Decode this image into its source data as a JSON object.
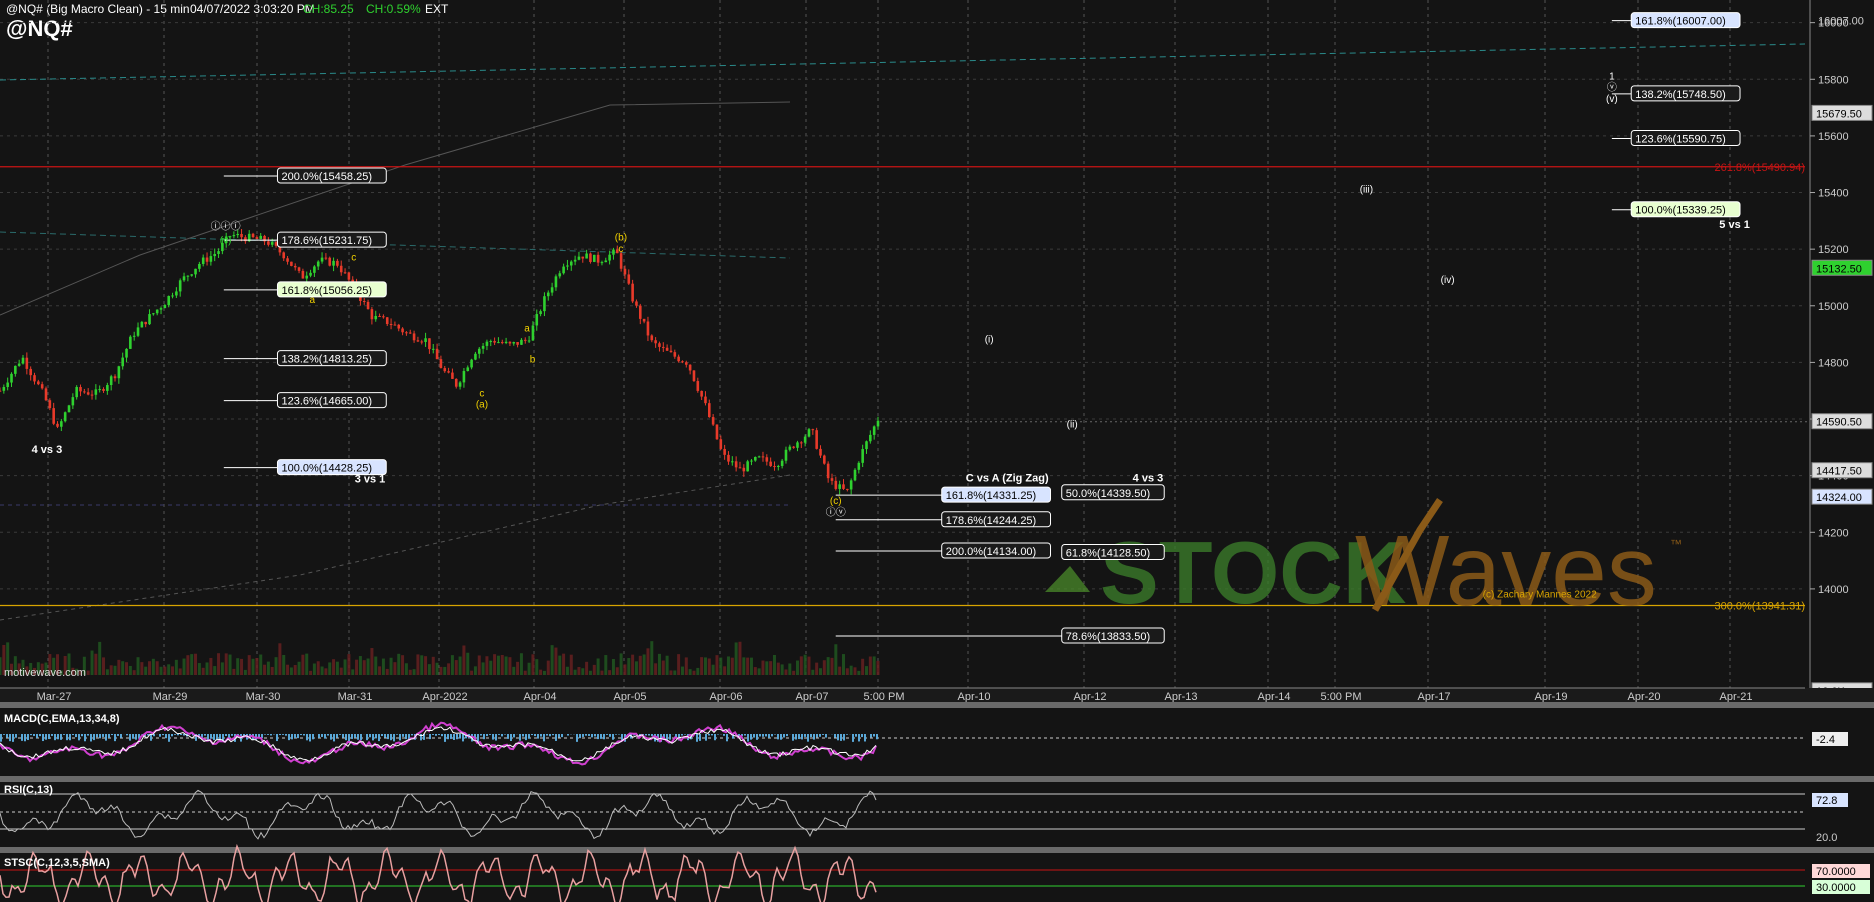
{
  "header": {
    "title": "@NQ# (Big Macro Clean) - 15 min",
    "datetime": "04/07/2022 3:03:20 PM",
    "change": "CH:85.25",
    "change_pct": "CH:0.59%",
    "session": "EXT",
    "symbol": "@NQ#"
  },
  "colors": {
    "background": "#141414",
    "up_candle": "#2fd12f",
    "down_candle": "#e83a2a",
    "fib_box_bg": "#1a1a1a",
    "fib_highlight_green": "#e8ffd0",
    "fib_highlight_blue": "#d8e4ff",
    "red_level": "#c81414",
    "orange_level": "#d8a400",
    "wave_label_yellow": "#f0d000",
    "watermark": "#4a8a2a"
  },
  "chart_data": {
    "type": "candlestick",
    "interval": "15 min",
    "ylim": [
      13650,
      16080
    ],
    "yticks": [
      16000,
      15800,
      15600,
      15400,
      15200,
      15000,
      14800,
      14600,
      14400,
      14200,
      14000
    ],
    "xticks": [
      "Mar-27",
      "Mar-29",
      "Mar-30",
      "Mar-31",
      "Apr-2022",
      "Apr-04",
      "Apr-05",
      "Apr-06",
      "Apr-07",
      "5:00 PM",
      "Apr-10",
      "Apr-12",
      "Apr-13",
      "Apr-14",
      "5:00 PM",
      "Apr-17",
      "Apr-19",
      "Apr-20",
      "Apr-21"
    ],
    "price_path": [
      [
        0.0,
        14700
      ],
      [
        0.5,
        14820
      ],
      [
        1.0,
        14680
      ],
      [
        1.3,
        14560
      ],
      [
        1.7,
        14700
      ],
      [
        2.2,
        14690
      ],
      [
        2.6,
        14760
      ],
      [
        3.0,
        14900
      ],
      [
        3.3,
        14950
      ],
      [
        3.7,
        15010
      ],
      [
        4.1,
        15090
      ],
      [
        4.5,
        15150
      ],
      [
        4.9,
        15190
      ],
      [
        5.2,
        15250
      ],
      [
        5.6,
        15240
      ],
      [
        6.0,
        15230
      ],
      [
        6.4,
        15180
      ],
      [
        6.8,
        15100
      ],
      [
        7.2,
        15160
      ],
      [
        7.6,
        15150
      ],
      [
        8.0,
        15060
      ],
      [
        8.4,
        14960
      ],
      [
        8.8,
        14940
      ],
      [
        9.2,
        14900
      ],
      [
        9.6,
        14880
      ],
      [
        10.0,
        14770
      ],
      [
        10.3,
        14720
      ],
      [
        10.7,
        14840
      ],
      [
        11.1,
        14880
      ],
      [
        11.5,
        14860
      ],
      [
        11.9,
        14880
      ],
      [
        12.3,
        15030
      ],
      [
        12.7,
        15150
      ],
      [
        13.1,
        15180
      ],
      [
        13.5,
        15160
      ],
      [
        13.9,
        15190
      ],
      [
        14.3,
        15010
      ],
      [
        14.7,
        14870
      ],
      [
        15.1,
        14830
      ],
      [
        15.5,
        14800
      ],
      [
        15.9,
        14650
      ],
      [
        16.3,
        14470
      ],
      [
        16.7,
        14420
      ],
      [
        17.1,
        14460
      ],
      [
        17.5,
        14440
      ],
      [
        17.9,
        14510
      ],
      [
        18.3,
        14560
      ],
      [
        18.7,
        14380
      ],
      [
        19.1,
        14340
      ],
      [
        19.4,
        14470
      ],
      [
        19.8,
        14600
      ]
    ],
    "current_price": "14590.50",
    "price_labels": [
      {
        "text": "16007.00",
        "value": 16007,
        "box": false
      },
      {
        "text": "15679.50",
        "value": 15679.5,
        "box": true
      },
      {
        "text": "15132.50",
        "value": 15132.5,
        "box": true,
        "green": true
      },
      {
        "text": "14590.50",
        "value": 14590.5,
        "box": true
      },
      {
        "text": "14417.50",
        "value": 14417.5,
        "box": true
      },
      {
        "text": "14324.00",
        "value": 14324,
        "box": true,
        "blue": true
      },
      {
        "text": "16.6K",
        "value": 13640,
        "box": true
      }
    ],
    "fib_levels": [
      {
        "label": "200.0%(15458.25)",
        "value": 15458.25,
        "x0": 0.124,
        "x1": 0.214
      },
      {
        "label": "178.6%(15231.75)",
        "value": 15231.75,
        "x0": 0.124,
        "x1": 0.214
      },
      {
        "label": "161.8%(15056.25)",
        "value": 15056.25,
        "x0": 0.124,
        "x1": 0.214,
        "highlight": "green"
      },
      {
        "label": "138.2%(14813.25)",
        "value": 14813.25,
        "x0": 0.124,
        "x1": 0.214
      },
      {
        "label": "123.6%(14665.00)",
        "value": 14665,
        "x0": 0.124,
        "x1": 0.214
      },
      {
        "label": "100.0%(14428.25)",
        "value": 14428.25,
        "x0": 0.124,
        "x1": 0.214,
        "highlight": "blue"
      },
      {
        "label": "161.8%(14331.25)",
        "value": 14331.25,
        "x0": 0.463,
        "x1": 0.582,
        "highlight": "blue"
      },
      {
        "label": "178.6%(14244.25)",
        "value": 14244.25,
        "x0": 0.463,
        "x1": 0.582
      },
      {
        "label": "200.0%(14134.00)",
        "value": 14134,
        "x0": 0.463,
        "x1": 0.582
      },
      {
        "label": "50.0%(14339.50)",
        "value": 14339.5,
        "x0": 0.595,
        "x1": 0.645
      },
      {
        "label": "61.8%(14128.50)",
        "value": 14128.5,
        "x0": 0.595,
        "x1": 0.645
      },
      {
        "label": "78.6%(13833.50)",
        "value": 13833.5,
        "x0": 0.463,
        "x1": 0.645
      },
      {
        "label": "161.8%(16007.00)",
        "value": 16007,
        "x0": 0.893,
        "x1": 0.964,
        "highlight": "blue"
      },
      {
        "label": "138.2%(15748.50)",
        "value": 15748.5,
        "x0": 0.893,
        "x1": 0.964
      },
      {
        "label": "123.6%(15590.75)",
        "value": 15590.75,
        "x0": 0.893,
        "x1": 0.964
      },
      {
        "label": "100.0%(15339.25)",
        "value": 15339.25,
        "x0": 0.893,
        "x1": 0.964,
        "highlight": "green"
      }
    ],
    "horizontal_levels": [
      {
        "label": "261.8%(15490.94)",
        "value": 15490.94,
        "color": "#c81414"
      },
      {
        "label": "300.0%(13941.31)",
        "value": 13941.31,
        "color": "#d8a400"
      }
    ],
    "annotations": [
      {
        "text": "ⓘⓘⓘ",
        "x": 0.125,
        "value": 15270,
        "color": "#ffffff"
      },
      {
        "text": "(v)",
        "x": 0.125,
        "value": 15220,
        "color": "#2fd12f"
      },
      {
        "text": "a",
        "x": 0.173,
        "value": 15010,
        "color": "#f0d000"
      },
      {
        "text": "c",
        "x": 0.196,
        "value": 15160,
        "color": "#f0d000"
      },
      {
        "text": "c",
        "x": 0.267,
        "value": 14680,
        "color": "#f0d000"
      },
      {
        "text": "(a)",
        "x": 0.267,
        "value": 14640,
        "color": "#f0d000"
      },
      {
        "text": "a",
        "x": 0.292,
        "value": 14910,
        "color": "#f0d000"
      },
      {
        "text": "b",
        "x": 0.295,
        "value": 14800,
        "color": "#f0d000"
      },
      {
        "text": "(b)",
        "x": 0.344,
        "value": 15230,
        "color": "#f0d000"
      },
      {
        "text": "c",
        "x": 0.344,
        "value": 15190,
        "color": "#f0d000"
      },
      {
        "text": "(c)",
        "x": 0.463,
        "value": 14300,
        "color": "#f0d000"
      },
      {
        "text": "ⓘⓥ",
        "x": 0.463,
        "value": 14260,
        "color": "#ffffff"
      },
      {
        "text": "4 vs 3",
        "x": 0.026,
        "value": 14480,
        "color": "#ffffff"
      },
      {
        "text": "3 vs 1",
        "x": 0.205,
        "value": 14375,
        "color": "#ffffff"
      },
      {
        "text": "C vs A (Zig Zag)",
        "x": 0.558,
        "value": 14380,
        "color": "#ffffff"
      },
      {
        "text": "4 vs 3",
        "x": 0.636,
        "value": 14380,
        "color": "#ffffff"
      },
      {
        "text": "5 vs 1",
        "x": 0.961,
        "value": 15275,
        "color": "#ffffff"
      },
      {
        "text": "1",
        "x": 0.893,
        "value": 15800,
        "color": "#ffffff"
      },
      {
        "text": "ⓥ",
        "x": 0.893,
        "value": 15760,
        "color": "#ffffff"
      },
      {
        "text": "(v)",
        "x": 0.893,
        "value": 15720,
        "color": "#ffffff"
      },
      {
        "text": "(i)",
        "x": 0.548,
        "value": 14870,
        "color": "#ffffff"
      },
      {
        "text": "(ii)",
        "x": 0.594,
        "value": 14570,
        "color": "#ffffff"
      },
      {
        "text": "(iii)",
        "x": 0.757,
        "value": 15400,
        "color": "#ffffff"
      },
      {
        "text": "(iv)",
        "x": 0.802,
        "value": 15080,
        "color": "#ffffff"
      },
      {
        "text": "(c) Zachary Mannes 2022",
        "x": 0.853,
        "value": 13970,
        "color": "#d8a400"
      }
    ],
    "watermark": {
      "text_1": "STOCK",
      "text_2": "Waves",
      "mark": "™"
    },
    "indicators": [
      {
        "name": "MACD(C,EMA,13,34,8)",
        "value_label": "-2.4"
      },
      {
        "name": "RSI(C,13)",
        "value_label": "72.8",
        "level_label": "20.0"
      },
      {
        "name": "STSC(C,12,3,5,SMA)",
        "level_labels": [
          "70.0000",
          "30.0000"
        ]
      }
    ],
    "source": "motivewave.com"
  }
}
